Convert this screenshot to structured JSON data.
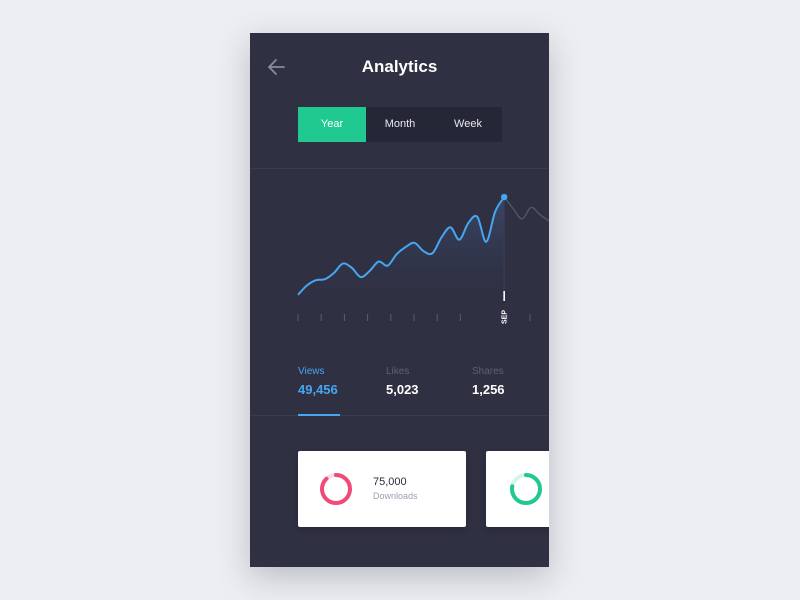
{
  "header": {
    "title": "Analytics",
    "back_icon": "arrow-left-icon"
  },
  "segments": [
    {
      "label": "Year",
      "active": true
    },
    {
      "label": "Month",
      "active": false
    },
    {
      "label": "Week",
      "active": false
    }
  ],
  "colors": {
    "accent_green": "#1fc98f",
    "accent_blue": "#47a6f2",
    "downloads_donut": "#ef4b7a",
    "second_donut": "#1fc98f",
    "phone_bg": "#2f3042"
  },
  "chart_data": {
    "type": "line",
    "highlight_label": "SEP",
    "tick_count": 11,
    "highlight_index": 8,
    "values": [
      5,
      14,
      19,
      20,
      26,
      35,
      31,
      22,
      28,
      37,
      33,
      44,
      51,
      55,
      47,
      45,
      60,
      70,
      58,
      74,
      80,
      56,
      85,
      99,
      88,
      78,
      89,
      82,
      76
    ],
    "highlight_point": 23
  },
  "stats": [
    {
      "label": "Views",
      "value": "49,456",
      "active": true
    },
    {
      "label": "Likes",
      "value": "5,023",
      "active": false
    },
    {
      "label": "Shares",
      "value": "1,256",
      "active": false
    }
  ],
  "cards": [
    {
      "value": "75,000",
      "label": "Downloads",
      "progress": 0.88
    },
    {
      "value": "",
      "label": "",
      "progress": 0.78
    }
  ]
}
